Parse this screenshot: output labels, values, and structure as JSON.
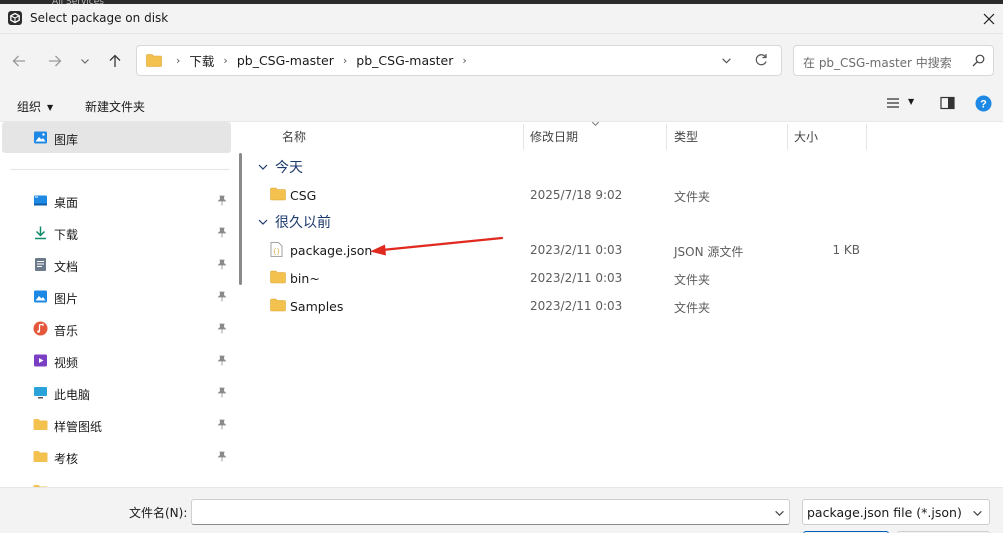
{
  "background_window": {
    "text": "All   Services"
  },
  "window": {
    "title": "Select package on disk"
  },
  "breadcrumb": [
    "下载",
    "pb_CSG-master",
    "pb_CSG-master"
  ],
  "search": {
    "placeholder": "在 pb_CSG-master 中搜索"
  },
  "command_bar": {
    "organize": "组织",
    "new_folder": "新建文件夹"
  },
  "sidebar": {
    "top_item": {
      "label": "图库",
      "icon": "gallery-icon"
    },
    "items": [
      {
        "label": "桌面",
        "icon": "desktop-icon",
        "pinned": true
      },
      {
        "label": "下载",
        "icon": "download-icon",
        "pinned": true
      },
      {
        "label": "文档",
        "icon": "document-icon",
        "pinned": true
      },
      {
        "label": "图片",
        "icon": "pictures-icon",
        "pinned": true
      },
      {
        "label": "音乐",
        "icon": "music-icon",
        "pinned": true
      },
      {
        "label": "视频",
        "icon": "video-icon",
        "pinned": true
      },
      {
        "label": "此电脑",
        "icon": "computer-icon",
        "pinned": true
      },
      {
        "label": "样管图纸",
        "icon": "folder-icon",
        "pinned": true
      },
      {
        "label": "考核",
        "icon": "folder-icon",
        "pinned": true
      }
    ]
  },
  "columns": {
    "name": "名称",
    "date": "修改日期",
    "type": "类型",
    "size": "大小"
  },
  "groups": [
    {
      "label": "今天",
      "files": [
        {
          "name": "CSG",
          "date": "2025/7/18 9:02",
          "type": "文件夹",
          "size": "",
          "icon": "folder-icon"
        }
      ]
    },
    {
      "label": "很久以前",
      "files": [
        {
          "name": "package.json",
          "date": "2023/2/11 0:03",
          "type": "JSON 源文件",
          "size": "1 KB",
          "icon": "json-file-icon"
        },
        {
          "name": "bin~",
          "date": "2023/2/11 0:03",
          "type": "文件夹",
          "size": "",
          "icon": "folder-icon"
        },
        {
          "name": "Samples",
          "date": "2023/2/11 0:03",
          "type": "文件夹",
          "size": "",
          "icon": "folder-icon"
        }
      ]
    }
  ],
  "bottom": {
    "filename_label": "文件名(N):",
    "filename_value": "",
    "filetype": "package.json file (*.json)"
  },
  "colors": {
    "accent": "#005fb8",
    "folder": "#f2c14e",
    "annotation_arrow": "#e02a1f",
    "group_header": "#1d3a6e"
  }
}
